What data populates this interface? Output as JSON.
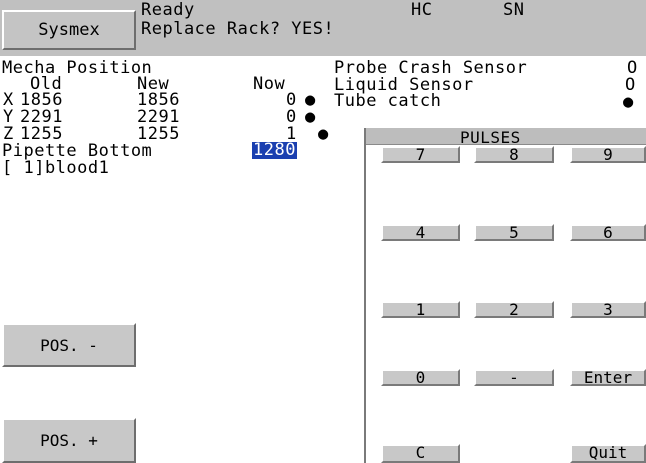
{
  "header": {
    "brand_button": "Sysmex",
    "status": "Ready",
    "message": "Replace Rack? YES!",
    "hc": "HC",
    "sn": "SN"
  },
  "mecha": {
    "title": "Mecha Position",
    "col_old": "Old",
    "col_new": "New",
    "col_now": "Now",
    "rows": [
      {
        "axis": "X",
        "old": "1856",
        "new": "1856",
        "now": "0"
      },
      {
        "axis": "Y",
        "old": "2291",
        "new": "2291",
        "now": "0"
      },
      {
        "axis": "Z",
        "old": "1255",
        "new": "1255",
        "now": "1"
      }
    ],
    "pipette_label": "Pipette Bottom",
    "pipette_value": "1280",
    "sample_line": "[ 1]blood1"
  },
  "sensors": {
    "probe_label": "Probe Crash Sensor",
    "probe_value": "O",
    "liquid_label": "Liquid Sensor",
    "liquid_value": "O",
    "tube_label": "Tube catch",
    "tube_value": "●"
  },
  "keypad": {
    "title": "PULSES",
    "keys": [
      "7",
      "8",
      "9",
      "4",
      "5",
      "6",
      "1",
      "2",
      "3",
      "0",
      "-",
      "Enter",
      "C",
      "Quit"
    ]
  },
  "buttons": {
    "pos_minus": "POS. -",
    "pos_plus": "POS. +"
  },
  "colors": {
    "header_bg": "#c0c0c0",
    "button_face": "#c8c8c8",
    "highlight_bg": "#1a3fb0",
    "highlight_fg": "#ffffff"
  }
}
